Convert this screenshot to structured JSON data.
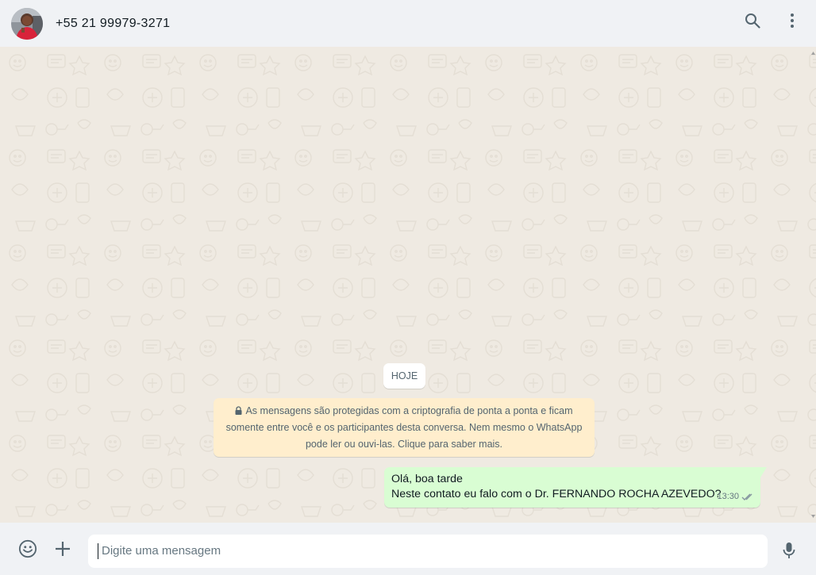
{
  "header": {
    "contact_name": "+55 21 99979-3271",
    "avatar_icon": "contact-photo",
    "search_icon": "search-icon",
    "menu_icon": "kebab-menu-icon"
  },
  "chat": {
    "date_label": "HOJE",
    "encryption_notice": "As mensagens são protegidas com a criptografia de ponta a ponta e ficam somente entre você e os participantes desta conversa. Nem mesmo o WhatsApp pode ler ou ouvi-las. Clique para saber mais.",
    "encryption_lines": [
      "As mensagens são protegidas com a criptografia de ponta a ponta e ficam",
      "somente entre você e os participantes desta conversa. Nem mesmo o WhatsApp",
      "pode ler ou ouvi-las. Clique para saber mais."
    ],
    "messages": [
      {
        "direction": "outgoing",
        "lines": [
          "Olá, boa tarde",
          "Neste contato eu falo com o Dr.  FERNANDO ROCHA AZEVEDO?"
        ],
        "time": "13:30",
        "status": "delivered"
      }
    ]
  },
  "footer": {
    "input_placeholder": "Digite uma mensagem",
    "input_value": ""
  },
  "colors": {
    "header_bg": "#f0f2f5",
    "chat_bg": "#efeae2",
    "outgoing_bubble": "#d9fdd3",
    "system_bubble": "#ffeecd",
    "icon_color": "#54656f"
  }
}
